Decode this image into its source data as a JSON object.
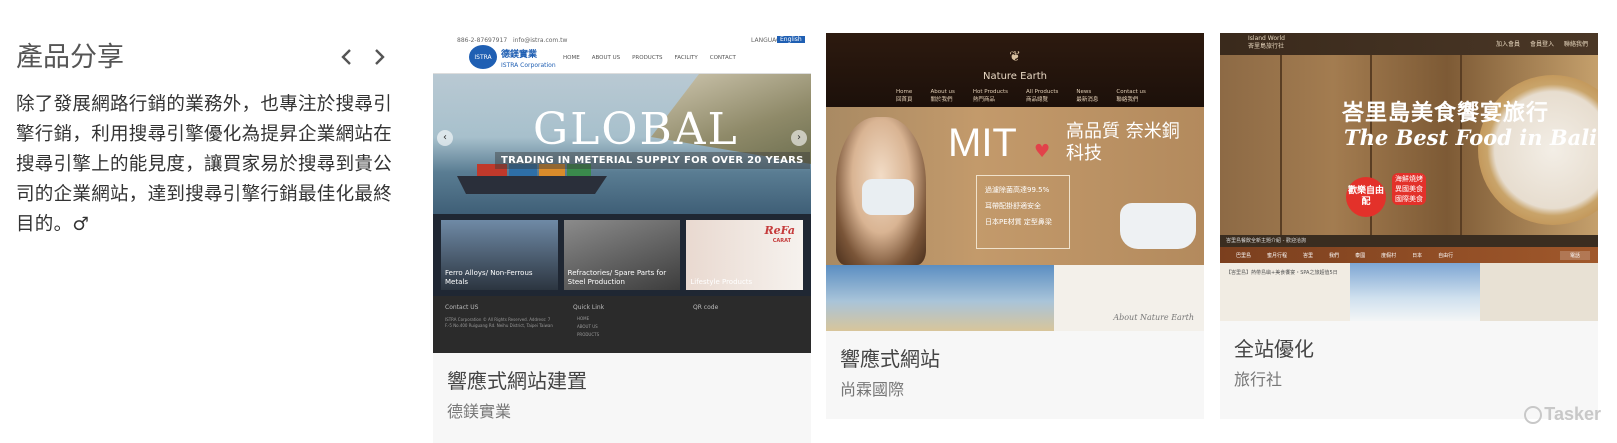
{
  "section": {
    "title": "產品分享",
    "description": "除了發展網路行銷的業務外，也專注於搜尋引擎行銷，利用搜尋引擎優化為提昇企業網站在搜尋引擎上的能見度，讓買家易於搜尋到貴公司的企業網站，達到搜尋引擎行銷最佳化最終目的。♂",
    "prev_icon": "chevron-left-icon",
    "next_icon": "chevron-right-icon"
  },
  "cards": [
    {
      "title": "響應式網站建置",
      "subtitle": "德鎂實業",
      "screenshot": {
        "phone": "886-2-87697917",
        "email": "info@istra.com.tw",
        "brand": "德鎂實業",
        "brand_en": "ISTRA Corporation",
        "logo_text": "ISTRA",
        "nav": [
          "HOME",
          "ABOUT US",
          "PRODUCTS",
          "FACILITY",
          "CONTACT"
        ],
        "language": "LANGUAGE",
        "language_value": "English",
        "hero_title": "GLOBAL",
        "hero_tagline": "TRADING IN METERIAL SUPPLY FOR OVER 20 YEARS",
        "categories": [
          "Ferro Alloys/ Non-Ferrous Metals",
          "Refractories/ Spare Parts for Steel Production",
          "Lifestyle Products"
        ],
        "refa_brand": "ReFa",
        "refa_sub": "CARAT",
        "footer_cols": [
          "Contact US",
          "Quick Link",
          "QR code"
        ],
        "footer_links": [
          "HOME",
          "ABOUT US",
          "PRODUCTS"
        ],
        "footer_text": "ISTRA Corporation © All Rights Reserved. Address: 7 F.-5 No.400 Ruiguang Rd. Neihu District, Taipei Taiwan"
      }
    },
    {
      "title": "響應式網站",
      "subtitle": "尚霖國際",
      "screenshot": {
        "brand": "Nature Earth",
        "nav": [
          "Home",
          "About us",
          "Hot Products",
          "All Products",
          "News",
          "Contact us"
        ],
        "nav_zh": [
          "回首頁",
          "關於我們",
          "熱門商品",
          "商品總覽",
          "最新消息",
          "聯絡我們"
        ],
        "hero_mit": "MIT",
        "hero_title": "高品質 奈米銅科技",
        "features": [
          "過濾除菌高達99.5%",
          "耳帶配掛舒適安全",
          "日本PE材質 定型鼻梁"
        ],
        "about": "About Nature Earth"
      }
    },
    {
      "title": "全站優化",
      "subtitle": "旅行社",
      "screenshot": {
        "brand": "Island World",
        "brand_zh": "峇里島旅行社",
        "topbar_links": [
          "加入會員",
          "會員登入",
          "聯絡我們"
        ],
        "hero_title": "峇里島美食饗宴旅行",
        "hero_subtitle": "The Best Food in Bali",
        "badge": "歡樂自由配",
        "tags": [
          "海鮮燒烤",
          "異國美食",
          "國際美食"
        ],
        "notice": "峇里島餐飲全新主題介紹 - 歡迎洽詢",
        "nav": [
          "巴里島",
          "蜜月行程",
          "峇里",
          "我們",
          "泰國",
          "度假村",
          "日本",
          "自由行"
        ],
        "search_label": "電話",
        "article_title": "【峇里島】熱帶島嶼+美食饗宴・SPA之旅超值5日"
      }
    }
  ],
  "watermark": "Tasker"
}
